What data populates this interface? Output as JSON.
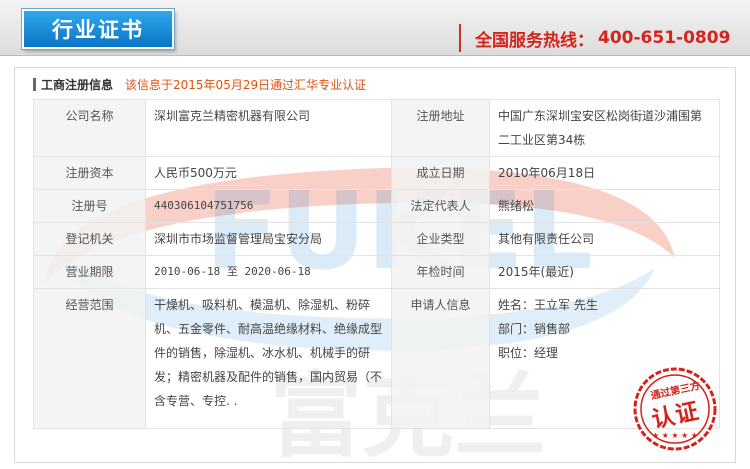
{
  "header": {
    "tab_title": "行业证书",
    "hotline_label": "全国服务热线：",
    "hotline_number": "400-651-0809"
  },
  "panel": {
    "section_title": "工商注册信息",
    "verify_note": "该信息于2015年05月29日通过汇华专业认证"
  },
  "watermark": {
    "letters": "FUKEL",
    "cn": "富克兰"
  },
  "table": {
    "company_label": "公司名称",
    "company_value": "深圳富克兰精密机器有限公司",
    "address_label": "注册地址",
    "address_value": "中国广东深圳宝安区松岗街道沙浦围第二工业区第34栋",
    "capital_label": "注册资本",
    "capital_value": "人民币500万元",
    "founded_label": "成立日期",
    "founded_value": "2010年06月18日",
    "regno_label": "注册号",
    "regno_value": "440306104751756",
    "legal_label": "法定代表人",
    "legal_value": "熊绪松",
    "authority_label": "登记机关",
    "authority_value": "深圳市市场监督管理局宝安分局",
    "type_label": "企业类型",
    "type_value": "其他有限责任公司",
    "term_label": "营业期限",
    "term_value": "2010-06-18 至 2020-06-18",
    "audit_label": "年检时间",
    "audit_value": "2015年(最近)",
    "scope_label": "经营范围",
    "scope_value": "干燥机、吸料机、模温机、除湿机、粉碎机、五金零件、耐高温绝缘材料、绝缘成型件的销售，除湿机、冰水机、机械手的研发；精密机器及配件的销售，国内贸易（不含专营、专控. .",
    "applicant_label": "申请人信息",
    "applicant_name": "姓名：王立军 先生",
    "applicant_dept": "部门：销售部",
    "applicant_title": "职位：经理"
  },
  "seal": {
    "top_text": "通过第三方",
    "main_text": "认证"
  },
  "colors": {
    "tab_blue": "#1a8fdc",
    "hotline_red": "#d4251d",
    "note_orange": "#e2520f",
    "seal_red": "#d2231c"
  }
}
